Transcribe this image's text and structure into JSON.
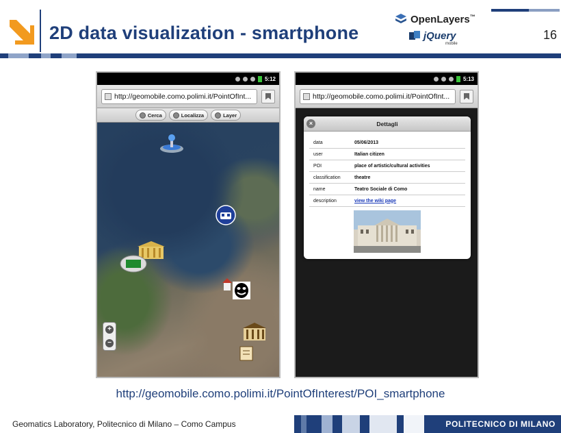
{
  "slide": {
    "title": "2D data visualization - smartphone",
    "page_number": "16",
    "logos": {
      "openlayers": "OpenLayers",
      "openlayers_tm": "™",
      "jquery": "jQuery",
      "jquery_sub": "mobile"
    },
    "caption_url": "http://geomobile.como.polimi.it/PointOfInterest/POI_smartphone",
    "footer_text": "Geomatics Laboratory, Politecnico di Milano – Como Campus",
    "footer_brand": "POLITECNICO DI MILANO",
    "colors": {
      "brand_blue": "#1f3f7a",
      "accent_orange": "#f29a1f",
      "link_blue": "#1a3ab8"
    }
  },
  "phone_left": {
    "status_time": "5:12",
    "url": "http://geomobile.como.polimi.it/PointOfInt...",
    "toolbar": [
      {
        "label": "Cerca",
        "icon": "search-icon"
      },
      {
        "label": "Localizza",
        "icon": "locate-icon"
      },
      {
        "label": "Layer",
        "icon": "layers-icon"
      }
    ],
    "zoom_in": "+",
    "zoom_out": "−"
  },
  "phone_right": {
    "status_time": "5:13",
    "url": "http://geomobile.como.polimi.it/PointOfInt...",
    "dialog": {
      "title": "Dettagli",
      "close": "×",
      "rows": [
        {
          "key": "data",
          "value": "05/06/2013"
        },
        {
          "key": "user",
          "value": "Italian citizen"
        },
        {
          "key": "POI",
          "value": "place of artistic/cultural activities"
        },
        {
          "key": "classification",
          "value": "theatre"
        },
        {
          "key": "name",
          "value": "Teatro Sociale di Como"
        },
        {
          "key": "description",
          "value": "view the wiki page"
        }
      ]
    }
  }
}
